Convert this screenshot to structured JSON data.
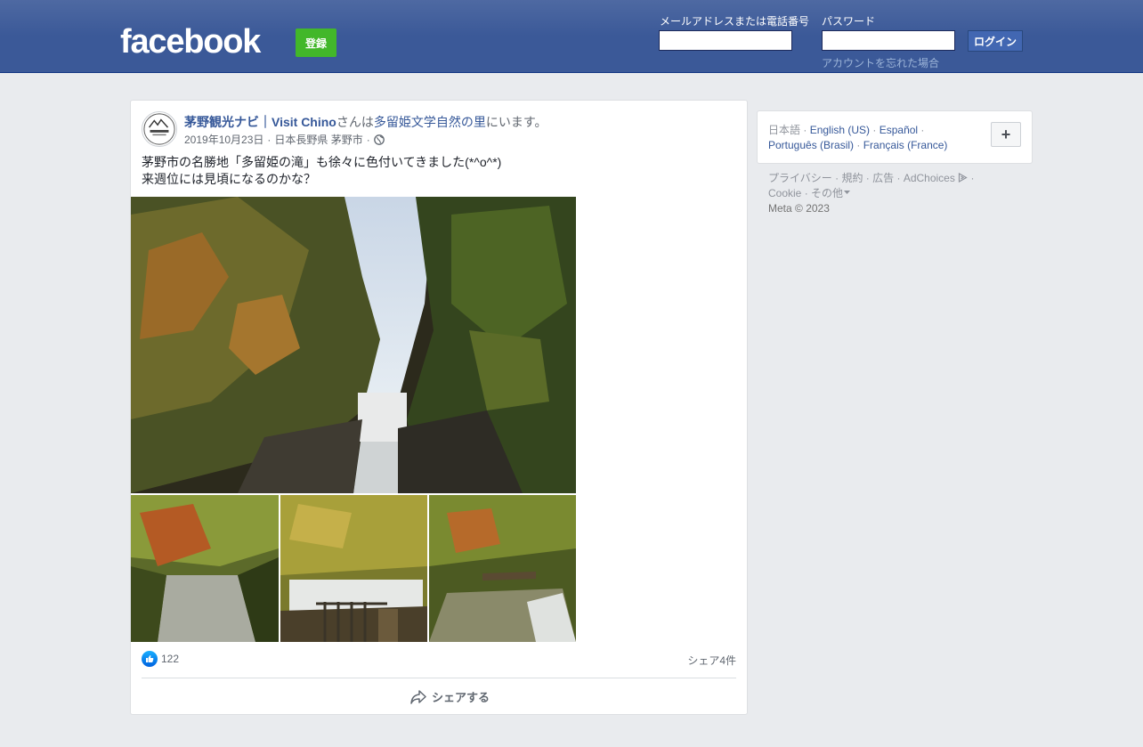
{
  "header": {
    "logo": "facebook",
    "signup_label": "登録",
    "email_label": "メールアドレスまたは電話番号",
    "password_label": "パスワード",
    "email_value": "",
    "password_value": "",
    "login_label": "ログイン",
    "forgot_label": "アカウントを忘れた場合"
  },
  "post": {
    "author": "茅野観光ナビ｜Visit Chino",
    "connector": "さんは",
    "place": "多留姫文学自然の里",
    "suffix": "にいます。",
    "date": "2019年10月23日",
    "sep1": " · ",
    "location": "日本長野県 茅野市",
    "sep2": " · ",
    "text_line1": "茅野市の名勝地「多留姫の滝」も徐々に色付いてきました(*^o^*)",
    "text_line2": "来週位には見頃になるのかな？",
    "likes": "122",
    "shares": "シェア4件",
    "share_button": "シェアする",
    "avatar_text": "茅野観光ナビ"
  },
  "sidebar": {
    "current_lang": "日本語",
    "languages": [
      "English (US)",
      "Español",
      "Português (Brasil)",
      "Français (France)"
    ],
    "plus_label": "+",
    "footer_links": [
      "プライバシー",
      "規約",
      "広告",
      "AdChoices",
      "Cookie",
      "その他"
    ],
    "copyright": "Meta © 2023"
  },
  "colors": {
    "brand": "#3b5998",
    "signup": "#42b72a",
    "link": "#365899",
    "background": "#e9ebee"
  },
  "icons": {
    "globe": "globe-icon",
    "like": "like-icon",
    "share": "share-icon",
    "adchoices": "adchoices-icon",
    "caret": "caret-down-icon"
  }
}
